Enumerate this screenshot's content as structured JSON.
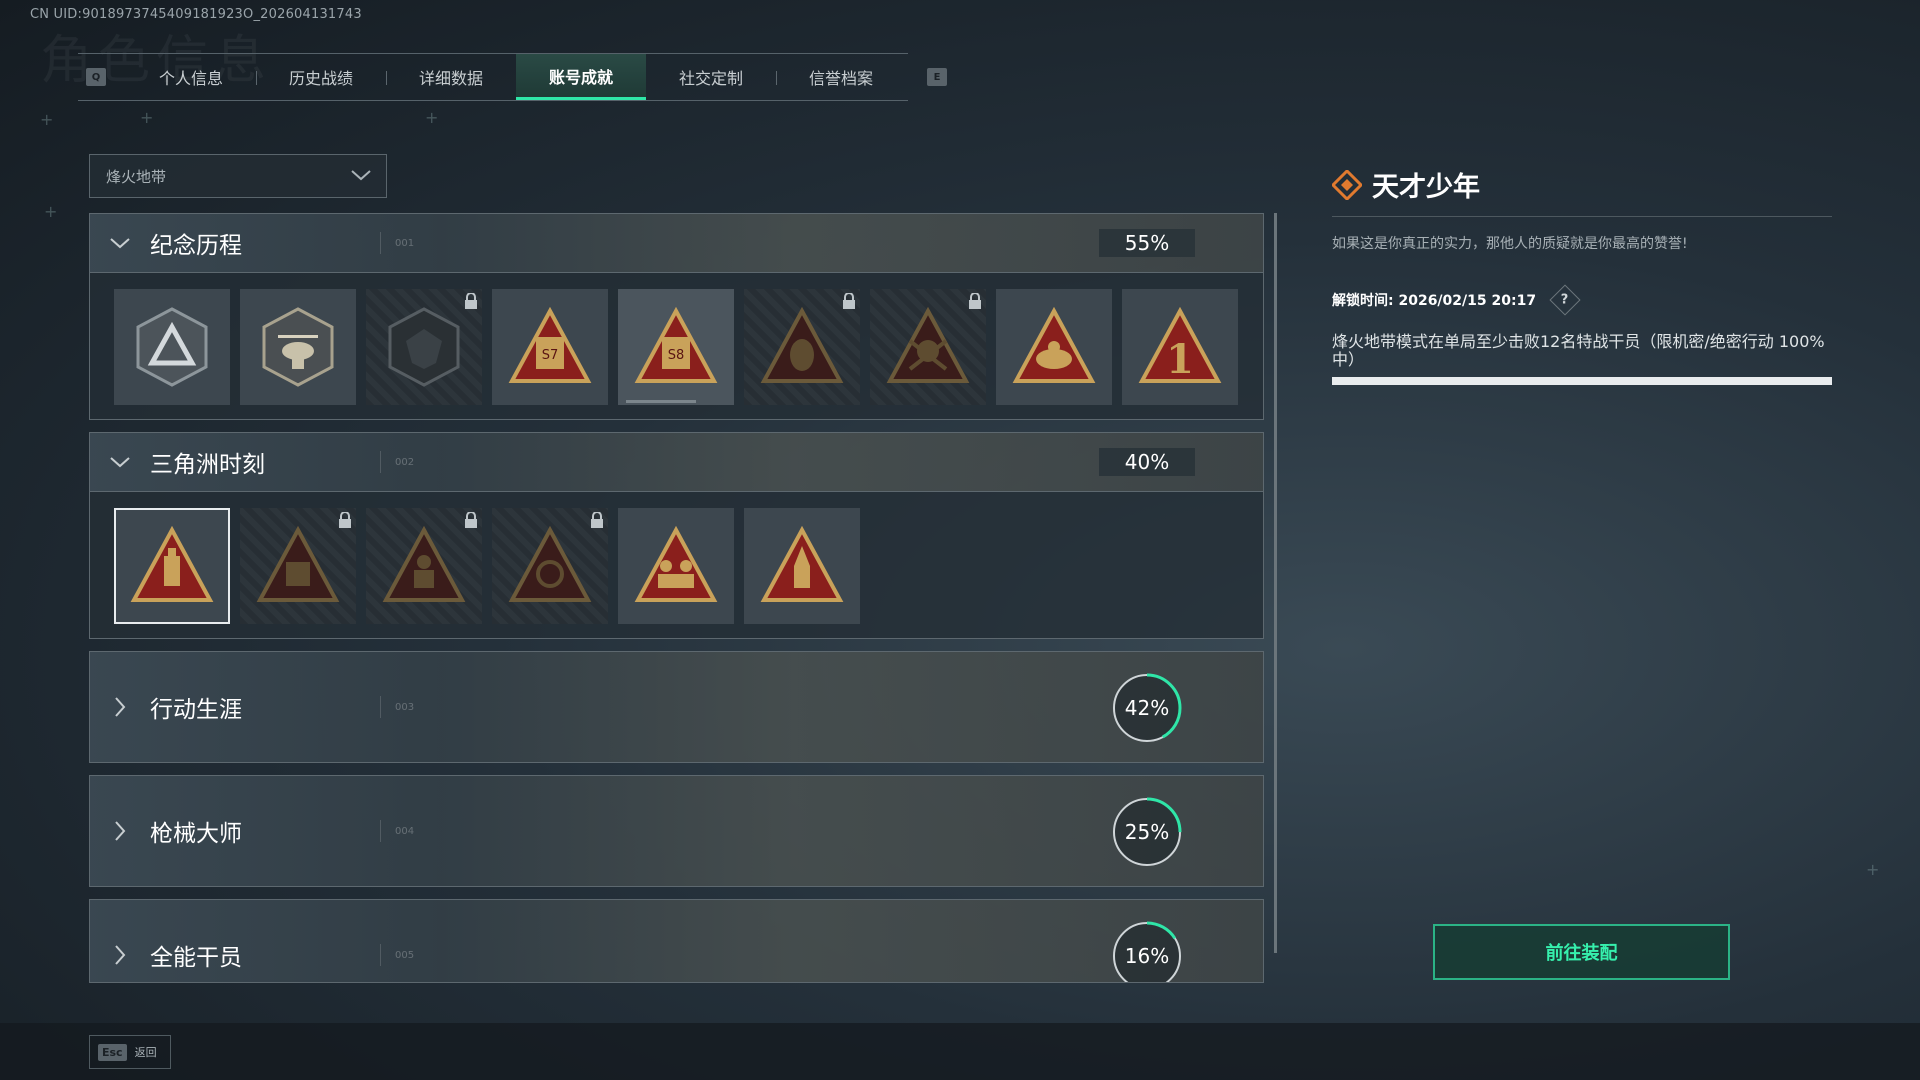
{
  "uid": "CN UID:9018973745409181923O_202604131743",
  "bg_title": "角色信息",
  "tabs": {
    "prev_key": "Q",
    "next_key": "E",
    "items": [
      {
        "label": "个人信息",
        "active": false
      },
      {
        "label": "历史战绩",
        "active": false
      },
      {
        "label": "详细数据",
        "active": false
      },
      {
        "label": "账号成就",
        "active": true
      },
      {
        "label": "社交定制",
        "active": false
      },
      {
        "label": "信誉档案",
        "active": false
      }
    ]
  },
  "mode_select": {
    "value": "烽火地带"
  },
  "categories": [
    {
      "name": "纪念历程",
      "code": "001",
      "percent": "55%",
      "expanded": true,
      "badges": [
        {
          "icon": "triangle-emblem-icon",
          "locked": false
        },
        {
          "icon": "helicopter-emblem-icon",
          "locked": false
        },
        {
          "icon": "shield-emblem-icon",
          "locked": true
        },
        {
          "icon": "season-57-emblem-icon",
          "label": "S7",
          "locked": false
        },
        {
          "icon": "season-58-emblem-icon",
          "label": "S8",
          "locked": false
        },
        {
          "icon": "mask-emblem-icon",
          "locked": true
        },
        {
          "icon": "skull-emblem-icon",
          "locked": true
        },
        {
          "icon": "hands-emblem-icon",
          "locked": false
        },
        {
          "icon": "number-one-emblem-icon",
          "label": "1",
          "locked": false
        }
      ]
    },
    {
      "name": "三角洲时刻",
      "code": "002",
      "percent": "40%",
      "expanded": true,
      "badges": [
        {
          "icon": "bottle-emblem-icon",
          "locked": false,
          "selected": true
        },
        {
          "icon": "robot-emblem-icon",
          "locked": true
        },
        {
          "icon": "soldier-emblem-icon",
          "locked": true
        },
        {
          "icon": "tank-emblem-icon",
          "locked": true
        },
        {
          "icon": "squad-emblem-icon",
          "locked": false
        },
        {
          "icon": "rocket-emblem-icon",
          "locked": false
        }
      ]
    },
    {
      "name": "行动生涯",
      "code": "003",
      "percent": "42%",
      "progress": 0.42,
      "expanded": false
    },
    {
      "name": "枪械大师",
      "code": "004",
      "percent": "25%",
      "progress": 0.25,
      "expanded": false
    },
    {
      "name": "全能干员",
      "code": "005",
      "percent": "16%",
      "progress": 0.16,
      "expanded": false
    }
  ],
  "detail": {
    "title": "天才少年",
    "description": "如果这是你真正的实力，那他人的质疑就是你最高的赞誉!",
    "unlock_time": "解锁时间: 2026/02/15 20:17",
    "help": "?",
    "requirement": "烽火地带模式在单局至少击败12名特战干员（限机密/绝密行动 100% 中）",
    "progress": 1.0
  },
  "equip_button": "前往装配",
  "back": {
    "key": "Esc",
    "label": "返回"
  },
  "colors": {
    "accent": "#2fe6a8",
    "badge_gold": "#c9a25a",
    "badge_red": "#8a1f1c",
    "diamond_orange": "#e07a2f"
  }
}
